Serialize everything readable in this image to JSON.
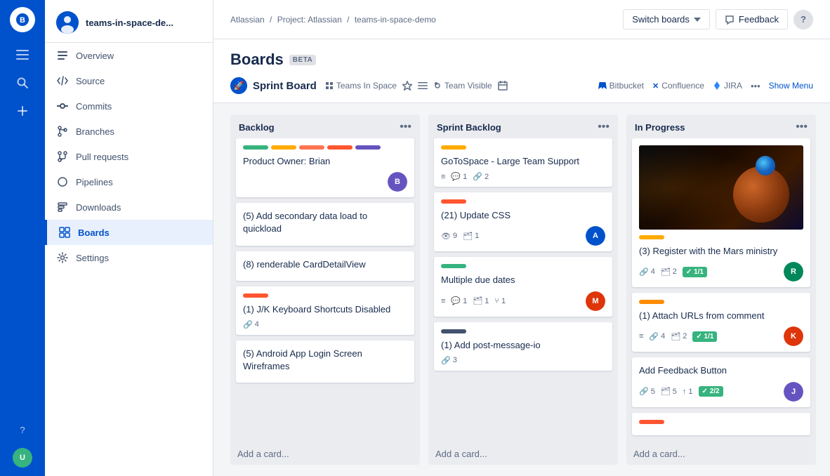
{
  "sidebar": {
    "icons": [
      "≡",
      "◎",
      "+"
    ],
    "bottom_icons": [
      "?",
      "👤"
    ]
  },
  "nav": {
    "project_name": "teams-in-space-de...",
    "items": [
      {
        "id": "overview",
        "label": "Overview",
        "icon": "≡"
      },
      {
        "id": "source",
        "label": "Source",
        "icon": "<>"
      },
      {
        "id": "commits",
        "label": "Commits",
        "icon": "◉"
      },
      {
        "id": "branches",
        "label": "Branches",
        "icon": "⑂"
      },
      {
        "id": "pull-requests",
        "label": "Pull requests",
        "icon": "⇄"
      },
      {
        "id": "pipelines",
        "label": "Pipelines",
        "icon": "○"
      },
      {
        "id": "downloads",
        "label": "Downloads",
        "icon": "▤"
      },
      {
        "id": "boards",
        "label": "Boards",
        "icon": "▦",
        "active": true
      },
      {
        "id": "settings",
        "label": "Settings",
        "icon": "⚙"
      }
    ]
  },
  "breadcrumb": {
    "items": [
      "Atlassian",
      "Project: Atlassian",
      "teams-in-space-demo"
    ]
  },
  "topbar": {
    "switch_boards_label": "Switch boards",
    "feedback_label": "Feedback",
    "help_label": "?"
  },
  "page": {
    "title": "Boards",
    "beta": "BETA"
  },
  "board_header": {
    "icon_alt": "rocket",
    "name": "Sprint Board",
    "workspace": "Teams In Space",
    "visibility": "Team Visible",
    "integrations": [
      {
        "id": "bitbucket",
        "label": "Bitbucket"
      },
      {
        "id": "confluence",
        "label": "Confluence"
      },
      {
        "id": "jira",
        "label": "JIRA"
      }
    ],
    "show_menu": "Show Menu"
  },
  "columns": [
    {
      "id": "backlog",
      "title": "Backlog",
      "cards": [
        {
          "id": "card-1",
          "colors": [
            "#36b37e",
            "#ffab00",
            "#ff7452",
            "#ff5630",
            "#6554c0"
          ],
          "title": "Product Owner: Brian",
          "meta": [],
          "avatar": {
            "initials": "B",
            "color": "#6554c0",
            "type": "person"
          }
        },
        {
          "id": "card-2",
          "colors": [],
          "title": "(5) Add secondary data load to quickload",
          "meta": [],
          "avatar": null
        },
        {
          "id": "card-3",
          "colors": [],
          "title": "(8) renderable CardDetailView",
          "meta": [],
          "avatar": null
        },
        {
          "id": "card-4",
          "colors": [
            "#ff5630"
          ],
          "title": "(1) J/K Keyboard Shortcuts Disabled",
          "meta": [
            {
              "icon": "🔗",
              "count": "4"
            }
          ],
          "avatar": null
        },
        {
          "id": "card-5",
          "colors": [],
          "title": "(5) Android App Login Screen Wireframes",
          "meta": [],
          "avatar": null
        }
      ],
      "add_label": "Add a card..."
    },
    {
      "id": "sprint-backlog",
      "title": "Sprint Backlog",
      "cards": [
        {
          "id": "card-6",
          "colors": [
            "#ffab00"
          ],
          "title": "GoToSpace - Large Team Support",
          "meta": [
            {
              "icon": "≡",
              "count": ""
            },
            {
              "icon": "💬",
              "count": "1"
            },
            {
              "icon": "🔗",
              "count": "2"
            }
          ],
          "avatar": null
        },
        {
          "id": "card-7",
          "colors": [
            "#ff5630"
          ],
          "title": "(21) Update CSS",
          "meta": [
            {
              "icon": "👁",
              "count": "9"
            },
            {
              "icon": "🗂",
              "count": "1"
            }
          ],
          "avatar": {
            "initials": "A",
            "color": "#0052cc",
            "type": "person"
          }
        },
        {
          "id": "card-8",
          "colors": [
            "#36b37e"
          ],
          "title": "Multiple due dates",
          "meta": [
            {
              "icon": "≡",
              "count": ""
            },
            {
              "icon": "💬",
              "count": "1"
            },
            {
              "icon": "🗂",
              "count": "1"
            },
            {
              "icon": "⑂",
              "count": "1"
            }
          ],
          "avatar": {
            "initials": "M",
            "color": "#de350b",
            "type": "person"
          }
        },
        {
          "id": "card-9",
          "colors": [
            "#42526e"
          ],
          "title": "(1) Add post-message-io",
          "meta": [
            {
              "icon": "🔗",
              "count": "3"
            }
          ],
          "avatar": null
        }
      ],
      "add_label": "Add a card..."
    },
    {
      "id": "in-progress",
      "title": "In Progress",
      "cards": [
        {
          "id": "card-10",
          "has_image": true,
          "colors": [
            "#ffab00"
          ],
          "title": "(3) Register with the Mars ministry",
          "meta": [
            {
              "icon": "🔗",
              "count": "4"
            },
            {
              "icon": "🗂",
              "count": "2"
            }
          ],
          "badge": "1/1",
          "avatar": {
            "initials": "R",
            "color": "#00875a",
            "type": "person"
          }
        },
        {
          "id": "card-11",
          "colors": [
            "#ff8b00"
          ],
          "title": "(1) Attach URLs from comment",
          "meta": [
            {
              "icon": "≡",
              "count": ""
            },
            {
              "icon": "🔗",
              "count": "4"
            },
            {
              "icon": "🗂",
              "count": "2"
            }
          ],
          "badge": "1/1",
          "avatar": {
            "initials": "K",
            "color": "#de350b",
            "type": "person"
          }
        },
        {
          "id": "card-12",
          "colors": [],
          "title": "Add Feedback Button",
          "meta": [
            {
              "icon": "🔗",
              "count": "5"
            },
            {
              "icon": "🗂",
              "count": "5"
            },
            {
              "icon": "↑",
              "count": "1"
            }
          ],
          "badge": "2/2",
          "avatar": {
            "initials": "J",
            "color": "#6554c0",
            "type": "person"
          }
        },
        {
          "id": "card-13",
          "colors": [
            "#ff5630"
          ],
          "title": "",
          "meta": [],
          "avatar": null,
          "is_stub": true
        }
      ],
      "add_label": "Add a card..."
    }
  ]
}
